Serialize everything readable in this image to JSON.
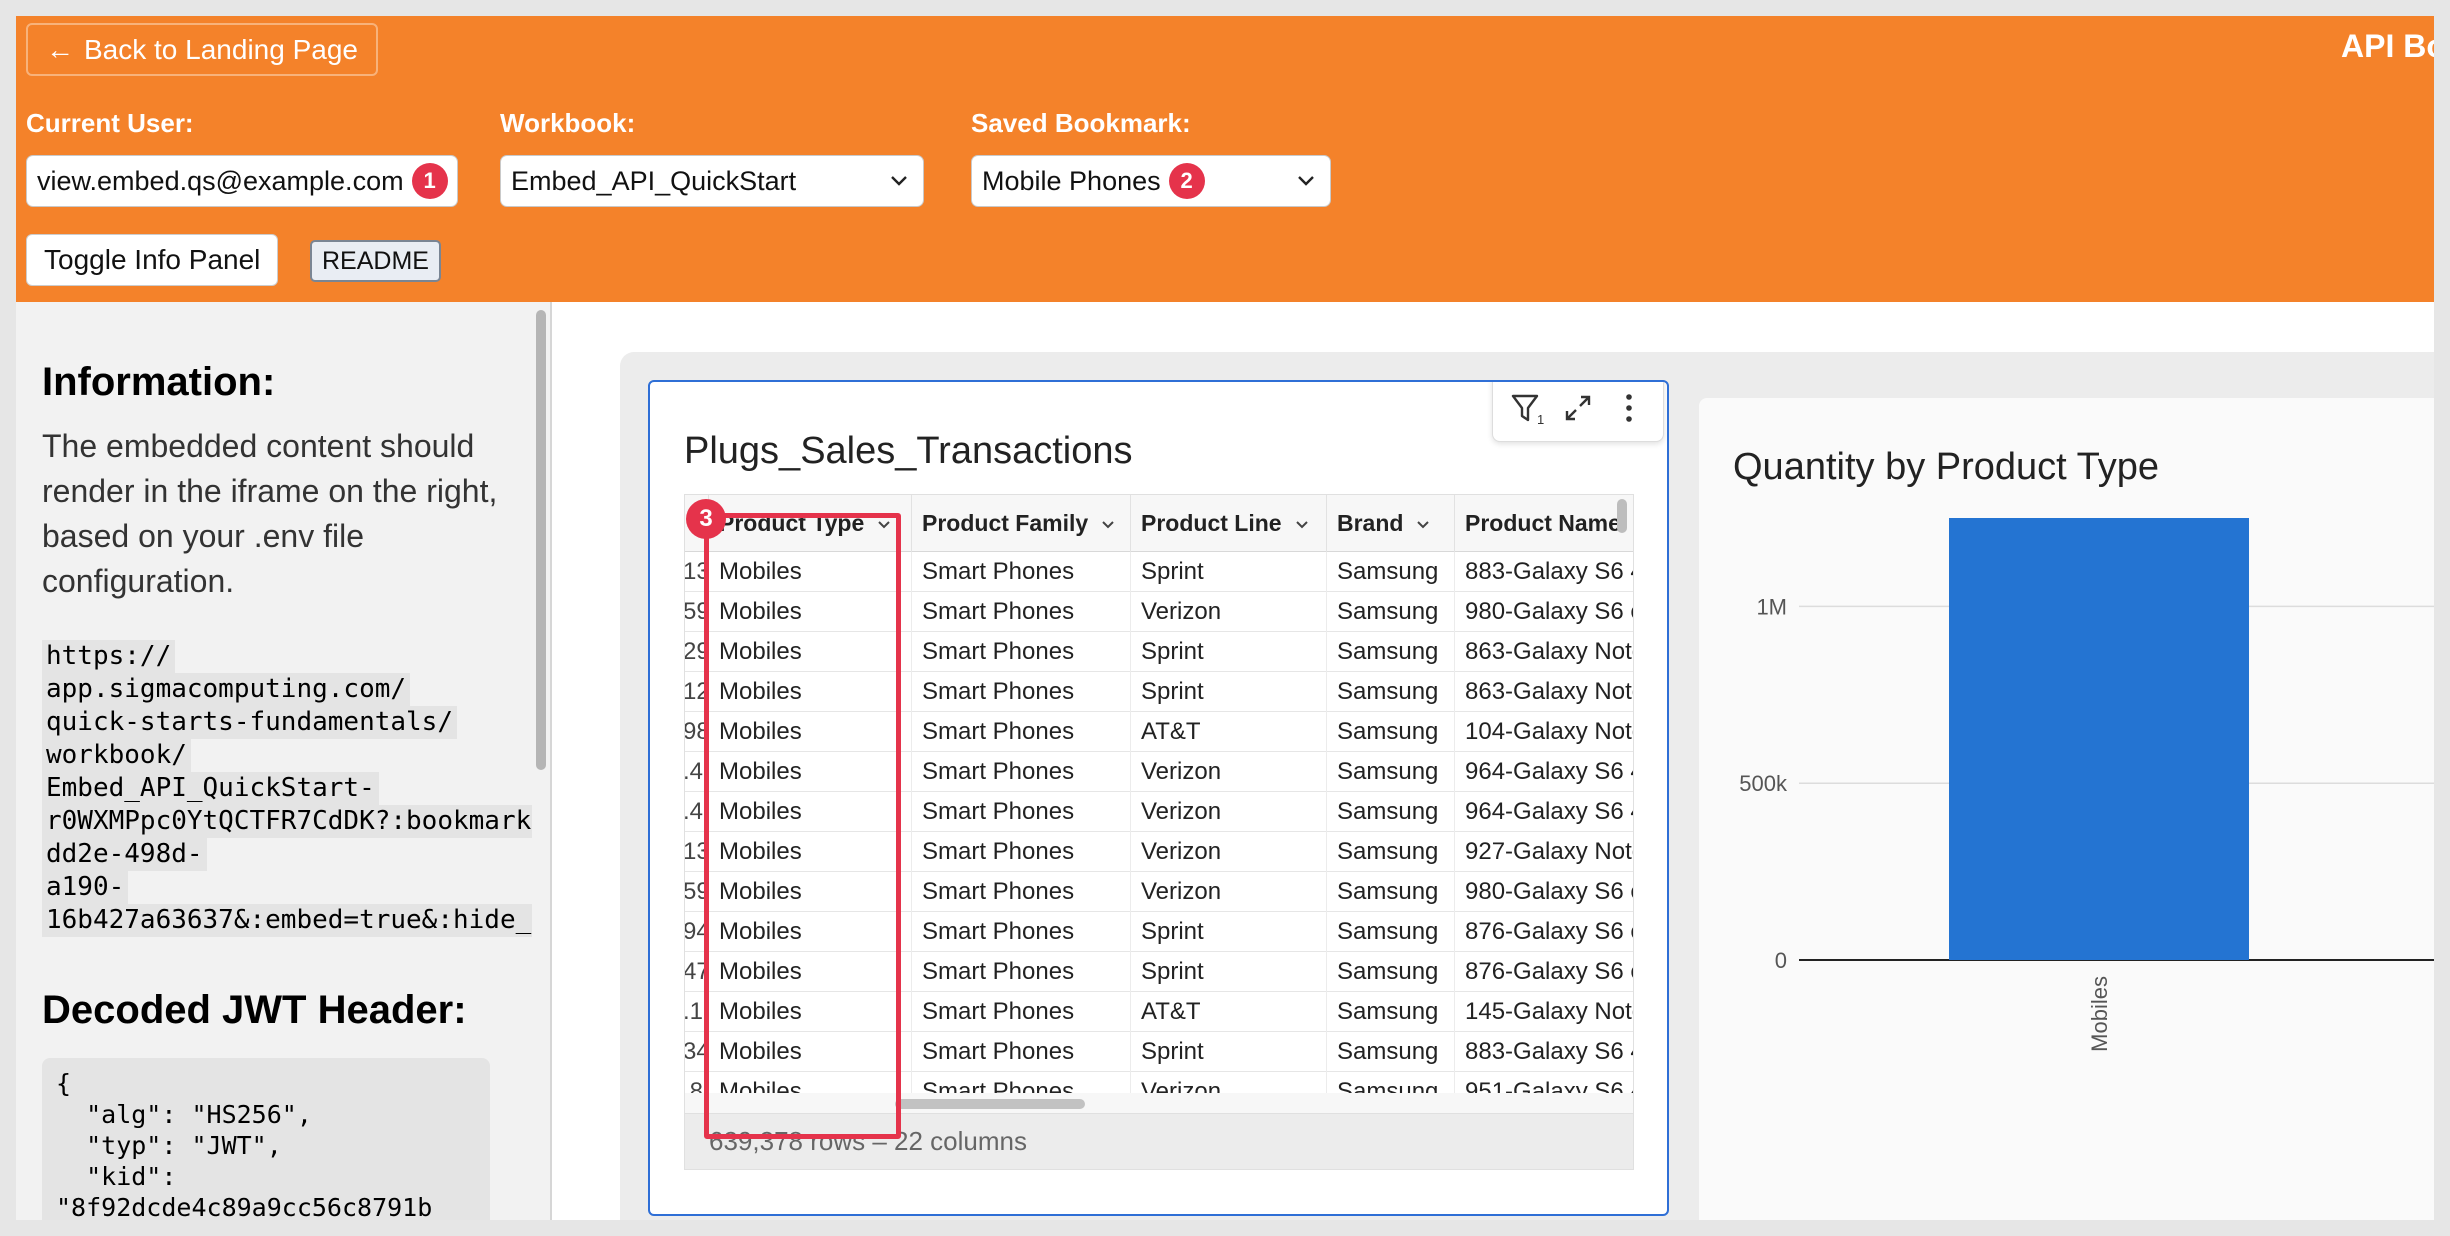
{
  "header": {
    "back_label": "Back to Landing Page",
    "title": "API Bo",
    "current_user": {
      "label": "Current User:",
      "value": "view.embed.qs@example.com",
      "badge": "1"
    },
    "workbook": {
      "label": "Workbook:",
      "value": "Embed_API_QuickStart"
    },
    "saved_bookmark": {
      "label": "Saved Bookmark:",
      "value": "Mobile Phones",
      "badge": "2"
    },
    "toggle_label": "Toggle Info Panel",
    "readme_label": "README"
  },
  "info_panel": {
    "heading": "Information:",
    "paragraph": "The embedded content should render in the iframe on the right, based on your .env file configuration.",
    "url_lines": [
      "https://",
      "app.sigmacomputing.com/",
      "quick-starts-fundamentals/",
      "workbook/",
      "Embed_API_QuickStart-",
      "r0WXMPpc0YtQCTFR7CdDK?:bookmark",
      "dd2e-498d-",
      "a190-",
      "16b427a63637&:embed=true&:hide_"
    ],
    "jwt_heading": "Decoded JWT Header:",
    "jwt_text": "{\n  \"alg\": \"HS256\",\n  \"typ\": \"JWT\",\n  \"kid\":\n\"8f92dcde4c89a9cc56c8791b"
  },
  "table": {
    "title": "Plugs_Sales_Transactions",
    "highlight_badge": "3",
    "columns": [
      "Product Type",
      "Product Family",
      "Product Line",
      "Brand",
      "Product Name"
    ],
    "row_prefixes": [
      "13",
      "59",
      "29",
      "12",
      "98",
      ".4",
      ".4",
      "13",
      "59",
      "94",
      "47",
      ".1",
      "34",
      ".8"
    ],
    "rows": [
      [
        "Mobiles",
        "Smart Phones",
        "Sprint",
        "Samsung",
        "883-Galaxy S6 4"
      ],
      [
        "Mobiles",
        "Smart Phones",
        "Verizon",
        "Samsung",
        "980-Galaxy S6 e"
      ],
      [
        "Mobiles",
        "Smart Phones",
        "Sprint",
        "Samsung",
        "863-Galaxy Note"
      ],
      [
        "Mobiles",
        "Smart Phones",
        "Sprint",
        "Samsung",
        "863-Galaxy Note"
      ],
      [
        "Mobiles",
        "Smart Phones",
        "AT&T",
        "Samsung",
        "104-Galaxy Note"
      ],
      [
        "Mobiles",
        "Smart Phones",
        "Verizon",
        "Samsung",
        "964-Galaxy S6 4"
      ],
      [
        "Mobiles",
        "Smart Phones",
        "Verizon",
        "Samsung",
        "964-Galaxy S6 4"
      ],
      [
        "Mobiles",
        "Smart Phones",
        "Verizon",
        "Samsung",
        "927-Galaxy Note"
      ],
      [
        "Mobiles",
        "Smart Phones",
        "Verizon",
        "Samsung",
        "980-Galaxy S6 e"
      ],
      [
        "Mobiles",
        "Smart Phones",
        "Sprint",
        "Samsung",
        "876-Galaxy S6 e"
      ],
      [
        "Mobiles",
        "Smart Phones",
        "Sprint",
        "Samsung",
        "876-Galaxy S6 e"
      ],
      [
        "Mobiles",
        "Smart Phones",
        "AT&T",
        "Samsung",
        "145-Galaxy Note"
      ],
      [
        "Mobiles",
        "Smart Phones",
        "Sprint",
        "Samsung",
        "883-Galaxy S6 4"
      ],
      [
        "Mobiles",
        "Smart Phones",
        "Verizon",
        "Samsung",
        "951-Galaxy S6 4"
      ]
    ],
    "footer": "639,378 rows – 22 columns",
    "filter_count": "1"
  },
  "chart_data": {
    "type": "bar",
    "title": "Quantity by Product Type",
    "categories": [
      "Mobiles"
    ],
    "values": [
      1250000
    ],
    "ylim": [
      0,
      1250000
    ],
    "yticks": [
      0,
      500000,
      1000000
    ],
    "ytick_labels": [
      "0",
      "500k",
      "1M"
    ],
    "xlabel": "",
    "ylabel": "",
    "bar_color": "#2474d2",
    "grid": true
  },
  "colors": {
    "header_bg": "#f4822a",
    "accent_red": "#e5334b",
    "selection_blue": "#2f6fd6"
  }
}
